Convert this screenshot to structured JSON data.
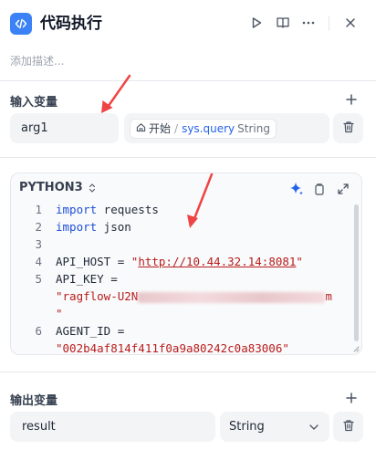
{
  "header": {
    "title": "代码执行",
    "description_placeholder": "添加描述..."
  },
  "input_section": {
    "label": "输入变量",
    "variable_name": "arg1",
    "reference": {
      "node": "开始",
      "separator": "/",
      "variable": "sys.query",
      "type": "String"
    }
  },
  "code_editor": {
    "language": "PYTHON3",
    "lines": [
      {
        "num": "1",
        "kw": "import",
        "rest": " requests"
      },
      {
        "num": "2",
        "kw": "import",
        "rest": " json"
      },
      {
        "num": "3"
      },
      {
        "num": "4",
        "pre": "API_HOST = ",
        "str_open": "\"",
        "url": "http://10.44.32.14:8081",
        "str_close": "\""
      },
      {
        "num": "5",
        "pre": "API_KEY ="
      },
      {
        "cont": "\"ragflow-U2N",
        "cont_end": "m"
      },
      {
        "cont": "\""
      },
      {
        "num": "6",
        "pre": "AGENT_ID ="
      },
      {
        "cont": "\"002b4af814f411f0a9a80242c0a83006\""
      }
    ]
  },
  "output_section": {
    "label": "输出变量",
    "variable_name": "result",
    "type": "String"
  },
  "colors": {
    "accent": "#3b82f6",
    "keyword": "#1d4ed8",
    "string": "#b91c1c",
    "annotation_arrow": "#ef4444"
  }
}
